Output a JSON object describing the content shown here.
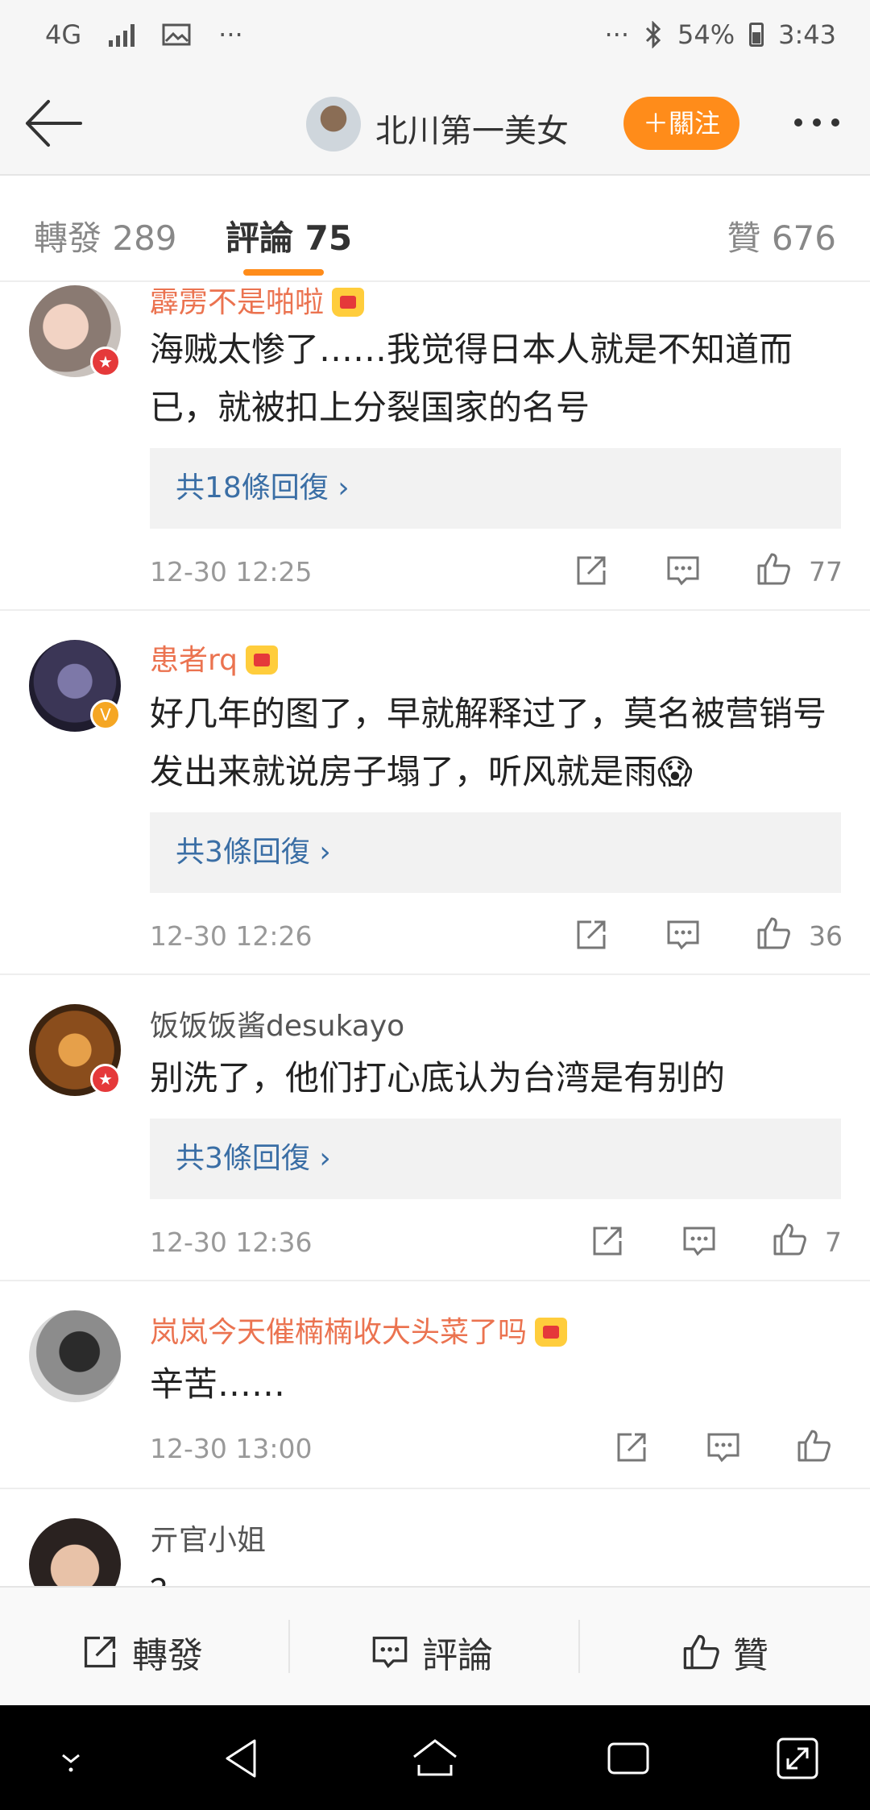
{
  "status_bar": {
    "network": "4G",
    "more_left": "···",
    "more_right": "···",
    "battery": "54%",
    "time": "3:43"
  },
  "nav": {
    "title": "北川第一美女",
    "follow_label": "＋關注"
  },
  "tabs": [
    {
      "label": "轉發 289"
    },
    {
      "label": "評論 75"
    },
    {
      "label": "贊 676"
    }
  ],
  "comments": [
    {
      "username": "霹雳不是啪啦",
      "text": "海贼太惨了……我觉得日本人就是不知道而已，就被扣上分裂国家的名号",
      "replies": "共18條回復 ›",
      "time": "12-30 12:25",
      "likes": "77"
    },
    {
      "username": "患者rq",
      "text": "好几年的图了，早就解释过了，莫名被营销号发出来就说房子塌了，听风就是雨😱",
      "replies": "共3條回復 ›",
      "time": "12-30 12:26",
      "likes": "36"
    },
    {
      "username": "饭饭饭酱desukayo",
      "text": "别洗了，他们打心底认为台湾是有别的",
      "replies": "共3條回復 ›",
      "time": "12-30 12:36",
      "likes": "7"
    },
    {
      "username": "岚岚今天催楠楠收大头菜了吗",
      "text": "辛苦……",
      "time": "12-30 13:00",
      "likes": ""
    },
    {
      "username": "亓官小姐",
      "text": "？"
    }
  ],
  "bottom_bar": {
    "repost": "轉發",
    "comment": "評論",
    "like": "贊"
  },
  "colors": {
    "accent_orange": "#ff8c1a",
    "vip_name": "#eb7350",
    "reply_link": "#3a6ea5"
  }
}
